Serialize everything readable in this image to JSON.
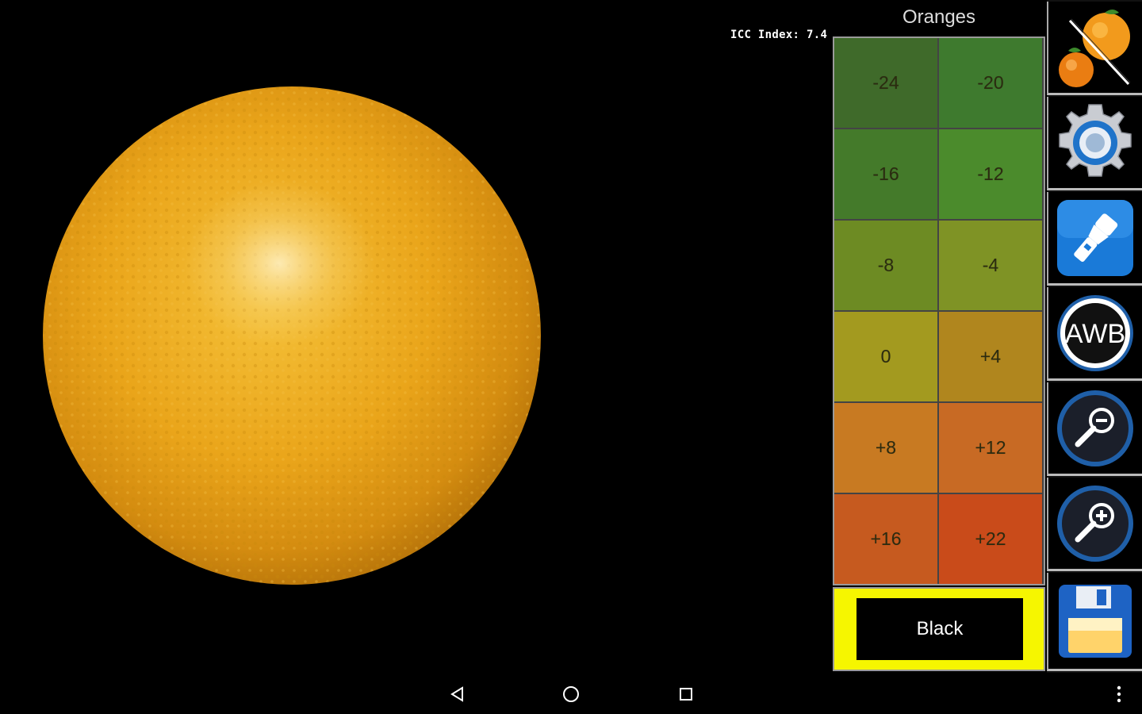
{
  "viewport": {
    "icc_index_text": "ICC Index: 7.4"
  },
  "panel": {
    "title": "Oranges",
    "scale": [
      {
        "label": "-24",
        "color": "#3f6a2a"
      },
      {
        "label": "-20",
        "color": "#3e7a2e"
      },
      {
        "label": "-16",
        "color": "#447a2a"
      },
      {
        "label": "-12",
        "color": "#4b8b2c"
      },
      {
        "label": "-8",
        "color": "#6d8b23"
      },
      {
        "label": "-4",
        "color": "#7f9325"
      },
      {
        "label": "0",
        "color": "#a39a1f"
      },
      {
        "label": "+4",
        "color": "#b0861e"
      },
      {
        "label": "+8",
        "color": "#c87a22"
      },
      {
        "label": "+12",
        "color": "#c86a24"
      },
      {
        "label": "+16",
        "color": "#c65a1f"
      },
      {
        "label": "+22",
        "color": "#c94b1a"
      }
    ],
    "black_button_label": "Black",
    "highlight_color": "#f6f600"
  },
  "toolbar": {
    "items": [
      {
        "name": "oranges-toggle",
        "icon": "orange-fruit-icon"
      },
      {
        "name": "settings",
        "icon": "gear-icon"
      },
      {
        "name": "flashlight",
        "icon": "flashlight-icon"
      },
      {
        "name": "awb",
        "icon": "awb-icon",
        "text": "AWB"
      },
      {
        "name": "zoom-out",
        "icon": "zoom-out-icon"
      },
      {
        "name": "zoom-in",
        "icon": "zoom-in-icon"
      },
      {
        "name": "save",
        "icon": "floppy-disk-icon"
      }
    ]
  },
  "navbar": {
    "buttons": [
      "back",
      "home",
      "recents",
      "overflow-menu"
    ]
  }
}
